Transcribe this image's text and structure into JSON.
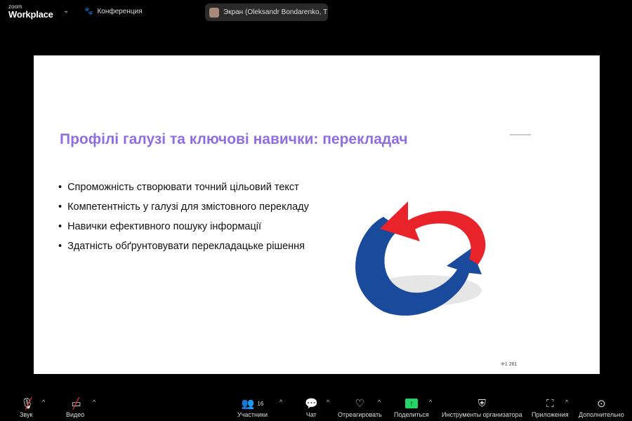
{
  "header": {
    "logo_small": "zoom",
    "logo_big": "Workplace",
    "meeting_label": "Конференция",
    "screen_label": "Экран (Oleksandr Bondarenko, Т"
  },
  "slide": {
    "title": "Профілі галузі та ключові навички: перекладач",
    "bullets": [
      "Спроможність створювати точний цільовий текст",
      "Компетентність у галузі для змістовного перекладу",
      "Навички ефективного пошуку інформації",
      "Здатність обґрунтовувати перекладацьке рішення"
    ],
    "mark": "1 261"
  },
  "toolbar": {
    "audio": "Звук",
    "video": "Видео",
    "participants": "Участники",
    "participants_count": "16",
    "chat": "Чат",
    "react": "Отреагировать",
    "share": "Поделиться",
    "host_tools": "Инструменты организатора",
    "apps": "Приложения",
    "more": "Дополнительно"
  },
  "colors": {
    "title": "#8e6ee0",
    "share": "#25d366",
    "arrow_red": "#e8242a",
    "arrow_blue": "#1a4a9c"
  }
}
